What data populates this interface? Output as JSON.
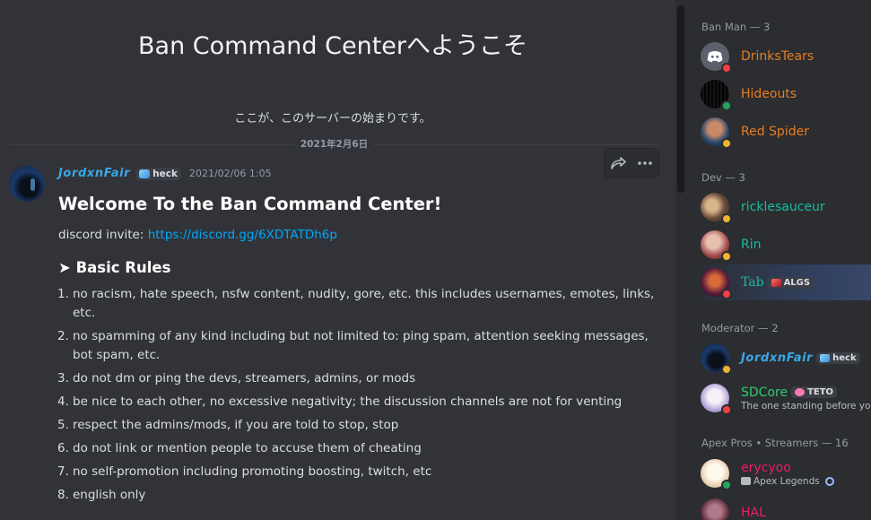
{
  "welcome": {
    "title": "Ban Command Centerへようこそ",
    "subtitle": "ここが、このサーバーの始まりです。",
    "date_divider": "2021年2月6日"
  },
  "message": {
    "author": "JordxnFair",
    "tag": "heck",
    "timestamp": "2021/02/06 1:05",
    "heading": "Welcome To the Ban Command Center!",
    "invite_prefix": "discord invite: ",
    "invite_link": "https://discord.gg/6XDTATDh6p",
    "rules_heading": "➤ Basic Rules",
    "rules": [
      "no racism, hate speech, nsfw content, nudity, gore, etc. this includes usernames, emotes, links, etc.",
      "no spamming of any kind including but not limited to: ping spam, attention seeking messages, bot spam, etc.",
      "do not dm or ping the devs, streamers, admins, or mods",
      "be nice to each other, no excessive negativity; the discussion channels are not for venting",
      "respect the admins/mods, if you are told to stop, stop",
      "do not link or mention people to accuse them of cheating",
      "no self-promotion including promoting boosting, twitch, etc",
      "english only"
    ],
    "rule_numbers": [
      "1.",
      "2.",
      "3.",
      "4.",
      "5.",
      "6.",
      "7.",
      "8."
    ],
    "actions": {
      "forward_icon": "forward-arrow-icon",
      "more_icon": "more-dots-icon"
    }
  },
  "members": {
    "groups": [
      {
        "title": "Ban Man — 3",
        "items": [
          {
            "name": "DrinksTears",
            "color": "#e67e22",
            "status": "dnd"
          },
          {
            "name": "Hideouts",
            "color": "#e67e22",
            "status": "online"
          },
          {
            "name": "Red Spider",
            "color": "#e67e22",
            "status": "idle"
          }
        ]
      },
      {
        "title": "Dev — 3",
        "items": [
          {
            "name": "ricklesauceur",
            "color": "#1abc9c",
            "status": "idle"
          },
          {
            "name": "Rin",
            "color": "#1abc9c",
            "status": "idle"
          },
          {
            "name": "Tab",
            "color": "#1abc9c",
            "status": "dnd",
            "tag": "ALGS"
          }
        ]
      },
      {
        "title": "Moderator — 2",
        "items": [
          {
            "name": "JordxnFair",
            "color": "#3ba7e6",
            "status": "idle",
            "tag": "heck"
          },
          {
            "name": "SDCore",
            "color": "#2ecc71",
            "status": "dnd",
            "tag": "TETO",
            "sub": "The one standing before you"
          }
        ]
      },
      {
        "title": "Apex Pros • Streamers — 16",
        "items": [
          {
            "name": "erycyoo",
            "color": "#e91e63",
            "status": "online",
            "sub": "Apex Legends"
          },
          {
            "name": "HAL",
            "color": "#e91e63",
            "status": "dnd"
          }
        ]
      }
    ]
  }
}
